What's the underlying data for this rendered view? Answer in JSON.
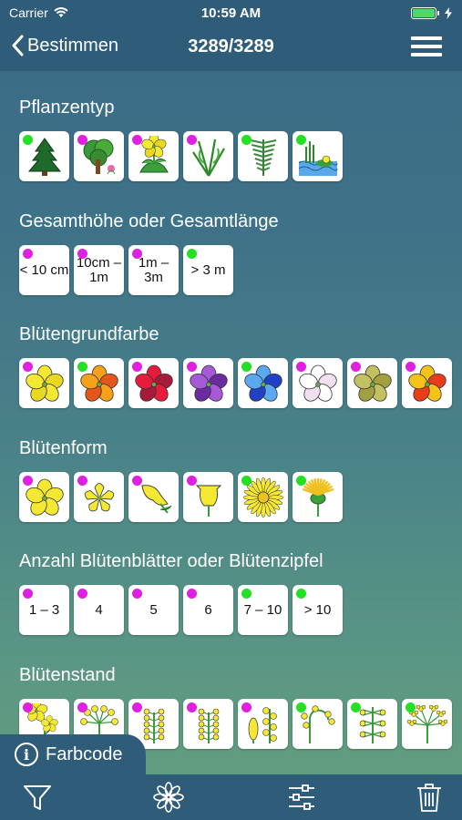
{
  "status": {
    "carrier": "Carrier",
    "time": "10:59 AM"
  },
  "nav": {
    "back_label": "Bestimmen",
    "title": "3289/3289"
  },
  "colors": {
    "magenta": "#e020e0",
    "green": "#22e022",
    "bar": "#2f5c78"
  },
  "sections": [
    {
      "title": "Pflanzentyp",
      "tiles": [
        {
          "icon": "conifer-tree-icon",
          "dot": "green"
        },
        {
          "icon": "deciduous-tree-icon",
          "dot": "magenta"
        },
        {
          "icon": "herb-flower-icon",
          "dot": "magenta"
        },
        {
          "icon": "grass-plant-icon",
          "dot": "magenta"
        },
        {
          "icon": "fern-icon",
          "dot": "green"
        },
        {
          "icon": "water-plant-icon",
          "dot": "green"
        }
      ]
    },
    {
      "title": "Gesamthöhe oder Gesamtlänge",
      "tiles": [
        {
          "text": "< 10 cm",
          "dot": "magenta"
        },
        {
          "text": "10cm – 1m",
          "dot": "magenta"
        },
        {
          "text": "1m – 3m",
          "dot": "magenta"
        },
        {
          "text": "> 3 m",
          "dot": "green"
        }
      ]
    },
    {
      "title": "Blütengrundfarbe",
      "tiles": [
        {
          "icon": "yellow-flower-icon",
          "dot": "magenta",
          "c1": "#f4e832",
          "c2": "#e8d820"
        },
        {
          "icon": "orange-flower-icon",
          "dot": "green",
          "c1": "#f7a11a",
          "c2": "#e4561a"
        },
        {
          "icon": "red-flower-icon",
          "dot": "magenta",
          "c1": "#e51c3c",
          "c2": "#a81a3a"
        },
        {
          "icon": "purple-flower-icon",
          "dot": "magenta",
          "c1": "#a65ad8",
          "c2": "#6a2aa0"
        },
        {
          "icon": "blue-flower-icon",
          "dot": "green",
          "c1": "#5aa8f0",
          "c2": "#2040c8"
        },
        {
          "icon": "white-flower-icon",
          "dot": "magenta",
          "c1": "#ffffff",
          "c2": "#f0e0f0"
        },
        {
          "icon": "green-flower-icon",
          "dot": "magenta",
          "c1": "#c2c060",
          "c2": "#a0a040"
        },
        {
          "icon": "multicolor-flower-icon",
          "dot": "magenta",
          "c1": "#f5c21a",
          "c2": "#e83c1a"
        }
      ]
    },
    {
      "title": "Blütenform",
      "tiles": [
        {
          "icon": "radial-flower-icon",
          "dot": "magenta"
        },
        {
          "icon": "star-flower-icon",
          "dot": "magenta"
        },
        {
          "icon": "lipped-flower-icon",
          "dot": "magenta"
        },
        {
          "icon": "bell-flower-icon",
          "dot": "magenta"
        },
        {
          "icon": "daisy-flower-icon",
          "dot": "green"
        },
        {
          "icon": "thistle-flower-icon",
          "dot": "green"
        }
      ]
    },
    {
      "title": "Anzahl Blütenblätter oder Blütenzipfel",
      "tiles": [
        {
          "text": "1 – 3",
          "dot": "magenta"
        },
        {
          "text": "4",
          "dot": "magenta"
        },
        {
          "text": "5",
          "dot": "magenta"
        },
        {
          "text": "6",
          "dot": "magenta"
        },
        {
          "text": "7 – 10",
          "dot": "green"
        },
        {
          "text": "> 10",
          "dot": "green"
        }
      ]
    },
    {
      "title": "Blütenstand",
      "tiles": [
        {
          "icon": "single-flower-icon",
          "dot": "magenta"
        },
        {
          "icon": "umbel-flower-icon",
          "dot": "magenta"
        },
        {
          "icon": "panicle-icon",
          "dot": "magenta"
        },
        {
          "icon": "raceme-icon",
          "dot": "magenta"
        },
        {
          "icon": "spike-icon",
          "dot": "magenta"
        },
        {
          "icon": "cyme-icon",
          "dot": "green"
        },
        {
          "icon": "whorl-icon",
          "dot": "green"
        },
        {
          "icon": "compound-umbel-icon",
          "dot": "green"
        }
      ]
    }
  ],
  "farbcode_label": "Farbcode",
  "toolbar": [
    "filter-icon",
    "flower-icon",
    "sliders-icon",
    "trash-icon"
  ]
}
